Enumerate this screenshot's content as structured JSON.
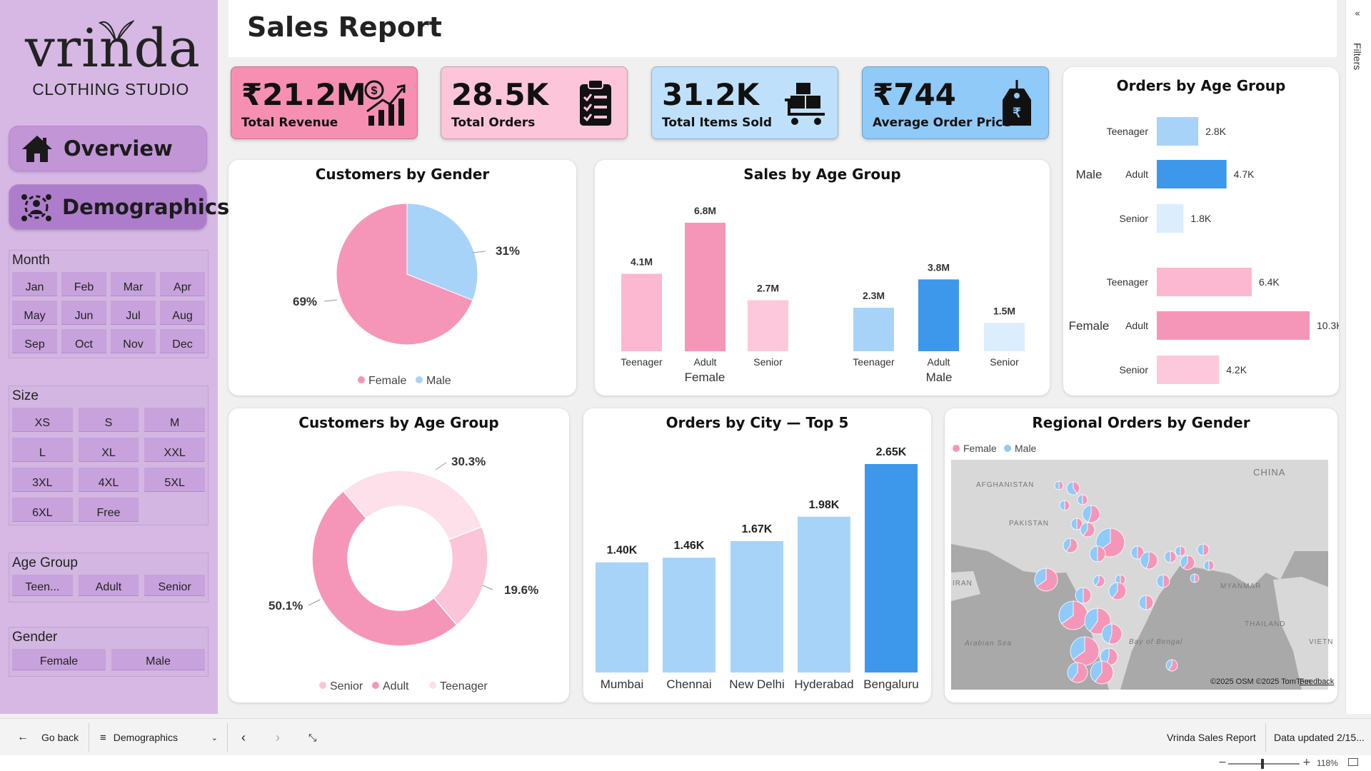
{
  "sidebar": {
    "logo_word": "vrinda",
    "logo_sub": "CLOTHING STUDIO",
    "nav": [
      {
        "label": "Overview",
        "icon": "home-icon"
      },
      {
        "label": "Demographics",
        "icon": "people-chart-icon"
      }
    ],
    "slicers": {
      "month": {
        "title": "Month",
        "items": [
          "Jan",
          "Feb",
          "Mar",
          "Apr",
          "May",
          "Jun",
          "Jul",
          "Aug",
          "Sep",
          "Oct",
          "Nov",
          "Dec"
        ]
      },
      "size": {
        "title": "Size",
        "items": [
          "XS",
          "S",
          "M",
          "L",
          "XL",
          "XXL",
          "3XL",
          "4XL",
          "5XL",
          "6XL",
          "Free"
        ]
      },
      "age": {
        "title": "Age Group",
        "items": [
          "Teen...",
          "Adult",
          "Senior"
        ]
      },
      "gender": {
        "title": "Gender",
        "items": [
          "Female",
          "Male"
        ]
      }
    }
  },
  "header": {
    "title": "Sales Report"
  },
  "kpis": [
    {
      "value": "₹21.2M",
      "label": "Total Revenue",
      "color": "#f78fb3",
      "icon": "revenue-growth-icon"
    },
    {
      "value": "28.5K",
      "label": "Total Orders",
      "color": "#fdc5da",
      "icon": "clipboard-checklist-icon"
    },
    {
      "value": "31.2K",
      "label": "Total Items Sold",
      "color": "#bfe0fb",
      "icon": "cart-boxes-icon"
    },
    {
      "value": "₹744",
      "label": "Average Order Price",
      "color": "#8fcaf8",
      "icon": "price-tag-icon"
    }
  ],
  "colors": {
    "female": "#f596b8",
    "female_light": "#fdc4d8",
    "female_lighter": "#fde0ea",
    "male": "#3d97ea",
    "male_light": "#a8d3f8",
    "male_lighter": "#dcedfd",
    "sidebar": "#d7b8e4",
    "chip": "#c8a2dc"
  },
  "charts": {
    "gender_pie": {
      "title": "Customers by Gender",
      "chart_data": {
        "type": "pie",
        "labels": [
          "Female",
          "Male"
        ],
        "values": [
          69,
          31
        ],
        "value_labels": [
          "69%",
          "31%"
        ],
        "legend": "bottom"
      }
    },
    "sales_age": {
      "title": "Sales by Age Group",
      "chart_data": {
        "type": "bar",
        "groups": [
          "Female",
          "Male"
        ],
        "categories": [
          "Teenager",
          "Adult",
          "Senior"
        ],
        "series": [
          {
            "group": "Female",
            "values": [
              4.1,
              6.8,
              2.7
            ],
            "labels": [
              "4.1M",
              "6.8M",
              "2.7M"
            ]
          },
          {
            "group": "Male",
            "values": [
              2.3,
              3.8,
              1.5
            ],
            "labels": [
              "2.3M",
              "3.8M",
              "1.5M"
            ]
          }
        ]
      }
    },
    "orders_age": {
      "title": "Orders by Age Group",
      "chart_data": {
        "type": "bar",
        "orientation": "horizontal",
        "groups": [
          "Male",
          "Female"
        ],
        "categories": [
          "Teenager",
          "Adult",
          "Senior"
        ],
        "series": [
          {
            "group": "Male",
            "values": [
              2.8,
              4.7,
              1.8
            ],
            "labels": [
              "2.8K",
              "4.7K",
              "1.8K"
            ]
          },
          {
            "group": "Female",
            "values": [
              6.4,
              10.3,
              4.2
            ],
            "labels": [
              "6.4K",
              "10.3K",
              "4.2K"
            ]
          }
        ]
      }
    },
    "cust_age": {
      "title": "Customers by Age Group",
      "chart_data": {
        "type": "pie",
        "donut": true,
        "labels": [
          "Senior",
          "Adult",
          "Teenager"
        ],
        "values": [
          19.6,
          50.1,
          30.3
        ],
        "value_labels": [
          "19.6%",
          "50.1%",
          "30.3%"
        ],
        "legend": "bottom"
      }
    },
    "city": {
      "title": "Orders by City — Top 5",
      "chart_data": {
        "type": "bar",
        "categories": [
          "Mumbai",
          "Chennai",
          "New Delhi",
          "Hyderabad",
          "Bengaluru"
        ],
        "values": [
          1.4,
          1.46,
          1.67,
          1.98,
          2.65
        ],
        "labels": [
          "1.40K",
          "1.46K",
          "1.67K",
          "1.98K",
          "2.65K"
        ]
      }
    },
    "map": {
      "title": "Regional Orders by Gender",
      "legend": [
        "Female",
        "Male"
      ],
      "place_labels": [
        "AFGHANISTAN",
        "PAKISTAN",
        "CHINA",
        "MYANMAR",
        "THAILAND",
        "VIETN",
        "Arabian Sea",
        "Bay of Bengal",
        "IRAN"
      ],
      "credits": "©2025 OSM  ©2025 TomTom",
      "feedback": "Feedback"
    }
  },
  "filters_pane": {
    "label": "Filters"
  },
  "bottombar": {
    "go_back": "Go back",
    "page": "Demographics",
    "report_name": "Vrinda Sales Report",
    "updated": "Data updated 2/15...",
    "zoom": "118%"
  }
}
